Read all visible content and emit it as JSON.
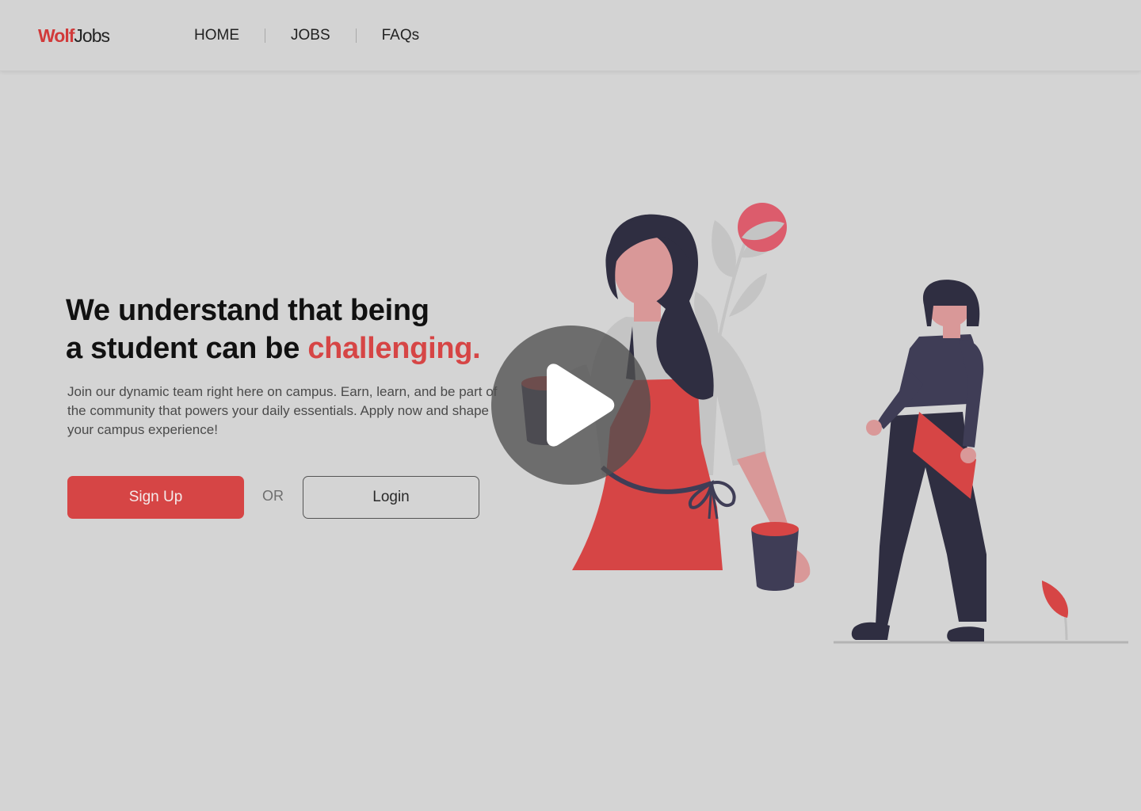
{
  "brand": {
    "part1": "Wolf",
    "part2": "Jobs"
  },
  "nav": {
    "items": [
      {
        "label": "HOME"
      },
      {
        "label": "JOBS"
      },
      {
        "label": "FAQs"
      }
    ]
  },
  "hero": {
    "headline_line1": "We understand that being",
    "headline_line2_prefix": "a student can be ",
    "headline_accent": "challenging.",
    "subtext": "Join our dynamic team right here on campus. Earn, learn, and be part of the community that powers your daily essentials. Apply now and shape your campus experience!",
    "signup_label": "Sign Up",
    "or_label": "OR",
    "login_label": "Login"
  },
  "colors": {
    "accent": "#d64545",
    "background": "#d4d4d4",
    "dark": "#2f2e41"
  },
  "icons": {
    "play": "play-icon"
  }
}
